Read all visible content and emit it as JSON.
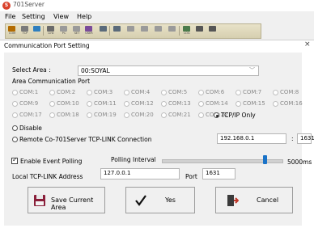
{
  "app": {
    "title": "701Server",
    "logo_text": "S"
  },
  "menu": [
    "File",
    "Setting",
    "View",
    "Help"
  ],
  "toolbar": {
    "icons": [
      {
        "name": "com-icon",
        "label": "COM",
        "color": "#b36b00"
      },
      {
        "name": "tcp-icon",
        "label": "TCP",
        "color": "#7a7a7a"
      },
      {
        "name": "refresh-icon",
        "label": "",
        "color": "#2f7fbf"
      },
      {
        "name": "link-icon",
        "label": "Link",
        "color": "#6a6a6a"
      },
      {
        "name": "pc-icon",
        "label": "PC",
        "color": "#9a9a9a"
      },
      {
        "name": "set-icon",
        "label": "SET",
        "color": "#9a9a9a"
      },
      {
        "name": "user-icon",
        "label": "USER",
        "color": "#7a4b9a"
      },
      {
        "name": "doc-icon",
        "label": "",
        "color": "#5a6a7a"
      },
      {
        "name": "report-icon",
        "label": "",
        "color": "#5a6a7a"
      },
      {
        "name": "arrow-icon",
        "label": "",
        "color": "#9a9a9a"
      },
      {
        "name": "network-icon",
        "label": "",
        "color": "#9a9a9a"
      },
      {
        "name": "camera-icon",
        "label": "",
        "color": "#9a9a9a"
      },
      {
        "name": "sync-icon",
        "label": "",
        "color": "#9a9a9a"
      },
      {
        "name": "log-icon",
        "label": "LOG",
        "color": "#4a7a4a"
      },
      {
        "name": "info-icon",
        "label": "",
        "color": "#555555"
      },
      {
        "name": "help-icon",
        "label": "",
        "color": "#555555"
      }
    ]
  },
  "dialog": {
    "title": "Communication Port Setting",
    "close": "×",
    "select_area_label": "Select Area :",
    "select_area_value": "00:SOYAL",
    "group_label": "Area Communication Port",
    "com_ports": [
      "COM:1",
      "COM:2",
      "COM:3",
      "COM:4",
      "COM:5",
      "COM:6",
      "COM:7",
      "COM:8",
      "COM:9",
      "COM:10",
      "COM:11",
      "COM:12",
      "COM:13",
      "COM:14",
      "COM:15",
      "COM:16",
      "COM:17",
      "COM:18",
      "COM:19",
      "COM:20",
      "COM:21",
      "COM:22"
    ],
    "tcp_only": "TCP/IP Only",
    "disable": "Disable",
    "remote_label": "Remote Co-701Server TCP-LINK Connection",
    "remote_ip": "192.168.0.1",
    "colon": ":",
    "remote_port": "1631",
    "polling_label": "Enable Event Polling",
    "polling_interval_label": "Polling Interval",
    "polling_value": "5000ms",
    "polling_level": 0.86,
    "local_label": "Local TCP-LINK Address",
    "local_ip": "127.0.0.1",
    "port_label": "Port",
    "local_port": "1631",
    "buttons": {
      "save": "Save Current Area",
      "yes": "Yes",
      "cancel": "Cancel"
    }
  }
}
